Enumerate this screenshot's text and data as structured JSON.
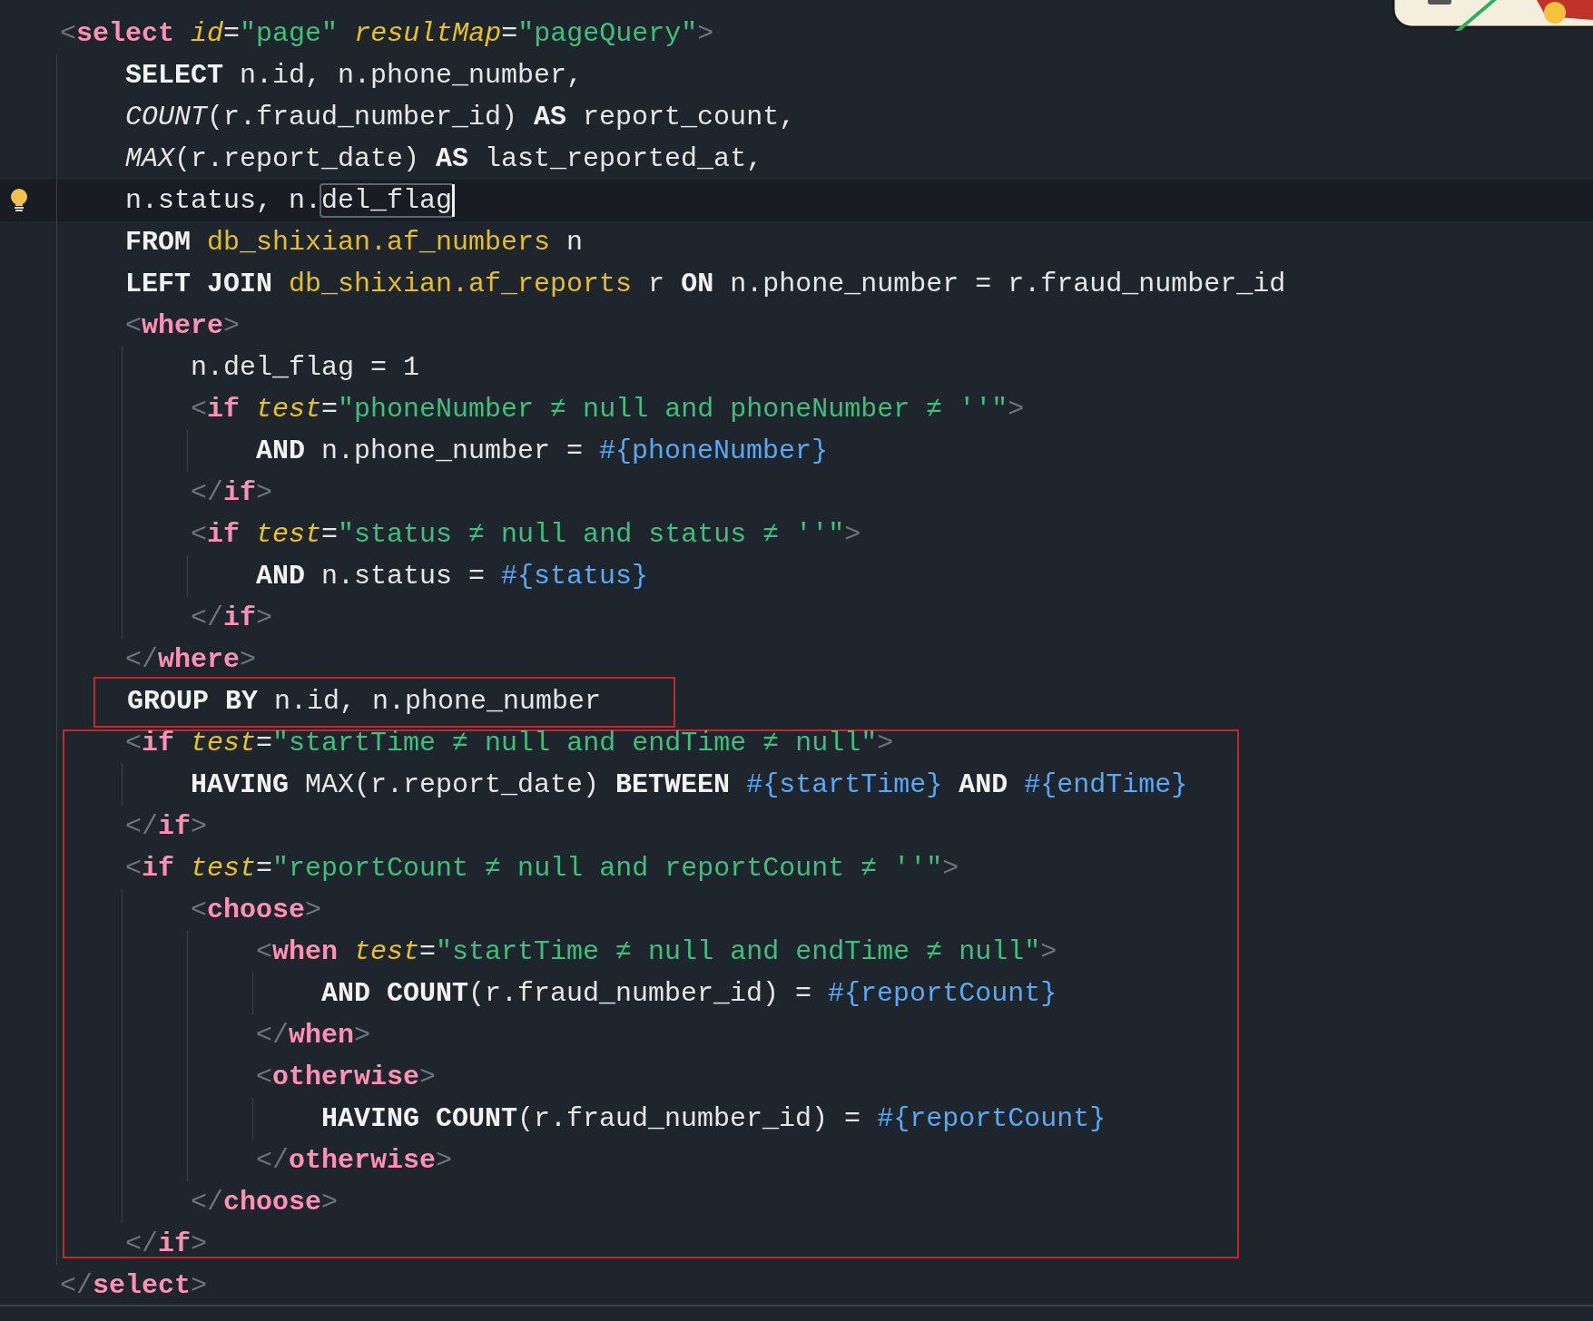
{
  "editor": {
    "lines": [
      {
        "tokens": [
          {
            "kind": "br",
            "text": "<"
          },
          {
            "kind": "tag",
            "text": "select",
            "space": true
          },
          {
            "kind": "attr",
            "text": "id"
          },
          {
            "kind": "txt",
            "text": "="
          },
          {
            "kind": "str",
            "text": "\"page\"",
            "space": true
          },
          {
            "kind": "attr",
            "text": "resultMap"
          },
          {
            "kind": "txt",
            "text": "="
          },
          {
            "kind": "str",
            "text": "\"pageQuery\""
          },
          {
            "kind": "br",
            "text": ">"
          }
        ],
        "children": [
          {
            "tokens": [
              {
                "kind": "kw",
                "text": "SELECT"
              },
              {
                "kind": "txt",
                "text": " n.id, n.phone_number,"
              }
            ]
          },
          {
            "tokens": [
              {
                "kind": "fn",
                "text": "COUNT"
              },
              {
                "kind": "txt",
                "text": "(r.fraud_number_id) "
              },
              {
                "kind": "kw",
                "text": "AS"
              },
              {
                "kind": "txt",
                "text": " report_count,"
              }
            ]
          },
          {
            "tokens": [
              {
                "kind": "fn",
                "text": "MAX"
              },
              {
                "kind": "txt",
                "text": "(r.report_date) "
              },
              {
                "kind": "kw",
                "text": "AS"
              },
              {
                "kind": "txt",
                "text": " last_reported_at,"
              }
            ]
          },
          {
            "current": true,
            "tokens": [
              {
                "kind": "txt",
                "text": "n.status, n."
              },
              {
                "kind": "txt",
                "text": "del_flag",
                "boxed": true,
                "cursor": true
              }
            ]
          },
          {
            "tokens": [
              {
                "kind": "kw",
                "text": "FROM",
                "space": true
              },
              {
                "kind": "tbl",
                "text": "db_shixian.af_numbers"
              },
              {
                "kind": "txt",
                "text": " n"
              }
            ]
          },
          {
            "tokens": [
              {
                "kind": "kw",
                "text": "LEFT JOIN",
                "space": true
              },
              {
                "kind": "tbl",
                "text": "db_shixian.af_reports"
              },
              {
                "kind": "txt",
                "text": " r "
              },
              {
                "kind": "kw",
                "text": "ON"
              },
              {
                "kind": "txt",
                "text": " n.phone_number = r.fraud_number_id"
              }
            ]
          },
          {
            "tokens": [
              {
                "kind": "br",
                "text": "<"
              },
              {
                "kind": "tag",
                "text": "where"
              },
              {
                "kind": "br",
                "text": ">"
              }
            ],
            "children": [
              {
                "tokens": [
                  {
                    "kind": "txt",
                    "text": "n.del_flag = 1"
                  }
                ]
              },
              {
                "tokens": [
                  {
                    "kind": "br",
                    "text": "<"
                  },
                  {
                    "kind": "tag",
                    "text": "if",
                    "space": true
                  },
                  {
                    "kind": "attr",
                    "text": "test"
                  },
                  {
                    "kind": "txt",
                    "text": "="
                  },
                  {
                    "kind": "str",
                    "text": "\"phoneNumber ≠ null and phoneNumber ≠ ''\""
                  },
                  {
                    "kind": "br",
                    "text": ">"
                  }
                ],
                "children": [
                  {
                    "tokens": [
                      {
                        "kind": "kw",
                        "text": "AND"
                      },
                      {
                        "kind": "txt",
                        "text": " n.phone_number = "
                      },
                      {
                        "kind": "param",
                        "text": "#{phoneNumber}"
                      }
                    ]
                  }
                ]
              },
              {
                "tokens": [
                  {
                    "kind": "br",
                    "text": "</"
                  },
                  {
                    "kind": "tag",
                    "text": "if"
                  },
                  {
                    "kind": "br",
                    "text": ">"
                  }
                ]
              },
              {
                "tokens": [
                  {
                    "kind": "br",
                    "text": "<"
                  },
                  {
                    "kind": "tag",
                    "text": "if",
                    "space": true
                  },
                  {
                    "kind": "attr",
                    "text": "test"
                  },
                  {
                    "kind": "txt",
                    "text": "="
                  },
                  {
                    "kind": "str",
                    "text": "\"status ≠ null and status ≠ ''\""
                  },
                  {
                    "kind": "br",
                    "text": ">"
                  }
                ],
                "children": [
                  {
                    "tokens": [
                      {
                        "kind": "kw",
                        "text": "AND"
                      },
                      {
                        "kind": "txt",
                        "text": " n.status = "
                      },
                      {
                        "kind": "param",
                        "text": "#{status}"
                      }
                    ]
                  }
                ]
              },
              {
                "tokens": [
                  {
                    "kind": "br",
                    "text": "</"
                  },
                  {
                    "kind": "tag",
                    "text": "if"
                  },
                  {
                    "kind": "br",
                    "text": ">"
                  }
                ]
              }
            ]
          },
          {
            "tokens": [
              {
                "kind": "br",
                "text": "</"
              },
              {
                "kind": "tag",
                "text": "where"
              },
              {
                "kind": "br",
                "text": ">"
              }
            ]
          },
          {
            "boxed": true,
            "tokens": [
              {
                "kind": "kw",
                "text": "GROUP BY"
              },
              {
                "kind": "txt",
                "text": " n.id, n.phone_number"
              }
            ]
          },
          {
            "tokens": [
              {
                "kind": "br",
                "text": "<"
              },
              {
                "kind": "tag",
                "text": "if",
                "space": true
              },
              {
                "kind": "attr",
                "text": "test"
              },
              {
                "kind": "txt",
                "text": "="
              },
              {
                "kind": "str",
                "text": "\"startTime ≠ null and endTime ≠ null\""
              },
              {
                "kind": "br",
                "text": ">"
              }
            ],
            "children": [
              {
                "tokens": [
                  {
                    "kind": "kw",
                    "text": "HAVING"
                  },
                  {
                    "kind": "txt",
                    "text": " MAX(r.report_date) "
                  },
                  {
                    "kind": "kw",
                    "text": "BETWEEN",
                    "space": true
                  },
                  {
                    "kind": "param",
                    "text": "#{startTime}",
                    "space": true
                  },
                  {
                    "kind": "kw",
                    "text": "AND",
                    "space": true
                  },
                  {
                    "kind": "param",
                    "text": "#{endTime}"
                  }
                ]
              }
            ]
          },
          {
            "tokens": [
              {
                "kind": "br",
                "text": "</"
              },
              {
                "kind": "tag",
                "text": "if"
              },
              {
                "kind": "br",
                "text": ">"
              }
            ]
          },
          {
            "tokens": [
              {
                "kind": "br",
                "text": "<"
              },
              {
                "kind": "tag",
                "text": "if",
                "space": true
              },
              {
                "kind": "attr",
                "text": "test"
              },
              {
                "kind": "txt",
                "text": "="
              },
              {
                "kind": "str",
                "text": "\"reportCount ≠ null and reportCount ≠ ''\""
              },
              {
                "kind": "br",
                "text": ">"
              }
            ],
            "children": [
              {
                "tokens": [
                  {
                    "kind": "br",
                    "text": "<"
                  },
                  {
                    "kind": "tag",
                    "text": "choose"
                  },
                  {
                    "kind": "br",
                    "text": ">"
                  }
                ],
                "children": [
                  {
                    "tokens": [
                      {
                        "kind": "br",
                        "text": "<"
                      },
                      {
                        "kind": "tag",
                        "text": "when",
                        "space": true
                      },
                      {
                        "kind": "attr",
                        "text": "test"
                      },
                      {
                        "kind": "txt",
                        "text": "="
                      },
                      {
                        "kind": "str",
                        "text": "\"startTime ≠ null and endTime ≠ null\""
                      },
                      {
                        "kind": "br",
                        "text": ">"
                      }
                    ],
                    "children": [
                      {
                        "tokens": [
                          {
                            "kind": "kw",
                            "text": "AND COUNT"
                          },
                          {
                            "kind": "txt",
                            "text": "(r.fraud_number_id) = "
                          },
                          {
                            "kind": "param",
                            "text": "#{reportCount}"
                          }
                        ]
                      }
                    ]
                  },
                  {
                    "tokens": [
                      {
                        "kind": "br",
                        "text": "</"
                      },
                      {
                        "kind": "tag",
                        "text": "when"
                      },
                      {
                        "kind": "br",
                        "text": ">"
                      }
                    ]
                  },
                  {
                    "tokens": [
                      {
                        "kind": "br",
                        "text": "<"
                      },
                      {
                        "kind": "tag",
                        "text": "otherwise"
                      },
                      {
                        "kind": "br",
                        "text": ">"
                      }
                    ],
                    "children": [
                      {
                        "tokens": [
                          {
                            "kind": "kw",
                            "text": "HAVING COUNT"
                          },
                          {
                            "kind": "txt",
                            "text": "(r.fraud_number_id) = "
                          },
                          {
                            "kind": "param",
                            "text": "#{reportCount}"
                          }
                        ]
                      }
                    ]
                  },
                  {
                    "tokens": [
                      {
                        "kind": "br",
                        "text": "</"
                      },
                      {
                        "kind": "tag",
                        "text": "otherwise"
                      },
                      {
                        "kind": "br",
                        "text": ">"
                      }
                    ]
                  }
                ]
              },
              {
                "tokens": [
                  {
                    "kind": "br",
                    "text": "</"
                  },
                  {
                    "kind": "tag",
                    "text": "choose"
                  },
                  {
                    "kind": "br",
                    "text": ">"
                  }
                ]
              }
            ]
          },
          {
            "tokens": [
              {
                "kind": "br",
                "text": "</"
              },
              {
                "kind": "tag",
                "text": "if"
              },
              {
                "kind": "br",
                "text": ">"
              }
            ]
          }
        ]
      },
      {
        "tokens": [
          {
            "kind": "br",
            "text": "</"
          },
          {
            "kind": "tag",
            "text": "select"
          },
          {
            "kind": "br",
            "text": ">"
          }
        ]
      }
    ]
  }
}
